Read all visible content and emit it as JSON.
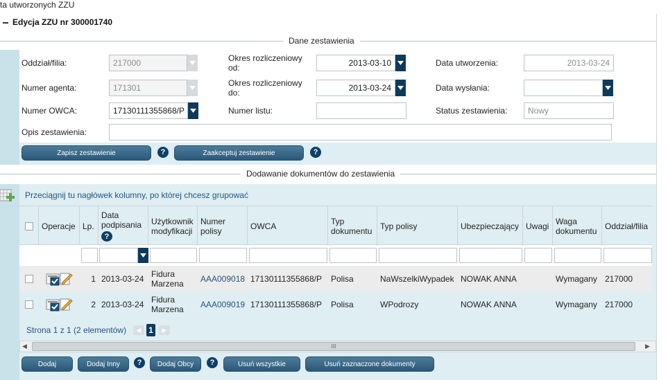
{
  "breadcrumb": "ta utworzonych ZZU",
  "edit_title": "Edycja ZZU nr 300001740",
  "section1": {
    "title": "Dane zestawienia",
    "oddzial_label": "Oddział/filia:",
    "oddzial_value": "217000",
    "agent_label": "Numer agenta:",
    "agent_value": "171301",
    "owca_label": "Numer OWCA:",
    "owca_value": "17130111355868/P",
    "okres_od_label_line1": "Okres rozliczeniowy",
    "okres_od_label_line2": "od:",
    "okres_od_value": "2013-03-10",
    "okres_do_label_line1": "Okres rozliczeniowy",
    "okres_do_label_line2": "do:",
    "okres_do_value": "2013-03-24",
    "numer_listu_label": "Numer listu:",
    "numer_listu_value": "",
    "data_utw_label": "Data utworzenia:",
    "data_utw_value": "2013-03-24",
    "data_wys_label": "Data wysłania:",
    "data_wys_value": "",
    "status_label": "Status zestawienia:",
    "status_value": "Nowy",
    "opis_label": "Opis zestawienia:",
    "opis_value": "",
    "btn_save": "Zapisz zestawienie",
    "btn_accept": "Zaakceptuj zestawienie"
  },
  "section2": {
    "title": "Dodawanie dokumentów do zestawienia",
    "group_hint": "Przeciągnij tu nagłówek kolumny, po której chcesz grupować",
    "columns": [
      {
        "l1": "Operacje",
        "l2": ""
      },
      {
        "l1": "Lp.",
        "l2": ""
      },
      {
        "l1": "Data",
        "l2": "podpisania"
      },
      {
        "l1": "Użytkownik",
        "l2": "modyfikacji"
      },
      {
        "l1": "Numer",
        "l2": "polisy"
      },
      {
        "l1": "OWCA",
        "l2": ""
      },
      {
        "l1": "Typ",
        "l2": "dokumentu"
      },
      {
        "l1": "Typ polisy",
        "l2": ""
      },
      {
        "l1": "Ubezpieczający",
        "l2": ""
      },
      {
        "l1": "Uwagi",
        "l2": ""
      },
      {
        "l1": "Waga",
        "l2": "dokumentu"
      },
      {
        "l1": "Oddział/filia",
        "l2": ""
      }
    ],
    "rows": [
      {
        "lp": "1",
        "data": "2013-03-24",
        "user1": "Fidura",
        "user2": "Marzena",
        "polisa": "AAA009018",
        "owca": "17130111355868/P",
        "typ_dok": "Polisa",
        "typ_pol": "NaWszelkiWypadek",
        "ubezp": "NOWAK ANNA",
        "uwagi": "",
        "waga": "Wymagany",
        "oddzial": "217000"
      },
      {
        "lp": "2",
        "data": "2013-03-24",
        "user1": "Fidura",
        "user2": "Marzena",
        "polisa": "AAA009019",
        "owca": "17130111355868/P",
        "typ_dok": "Polisa",
        "typ_pol": "WPodrozy",
        "ubezp": "NOWAK ANNA",
        "uwagi": "",
        "waga": "Wymagany",
        "oddzial": "217000"
      }
    ],
    "pager_text": "Strona 1 z 1 (2 elementów)",
    "current_page": "1",
    "scroll_grip": "III",
    "btn_dodaj": "Dodaj",
    "btn_dodaj_inny": "Dodaj Inny",
    "btn_dodaj_obcy": "Dodaj Obcy",
    "btn_usun_wszystkie": "Usuń wszystkie",
    "btn_usun_zaznaczone": "Usuń zaznaczone dokumenty"
  },
  "help_glyph": "?",
  "colors": {
    "panel": "#dfeef3",
    "accent": "#0e3a5c",
    "button": "#2b587a"
  }
}
